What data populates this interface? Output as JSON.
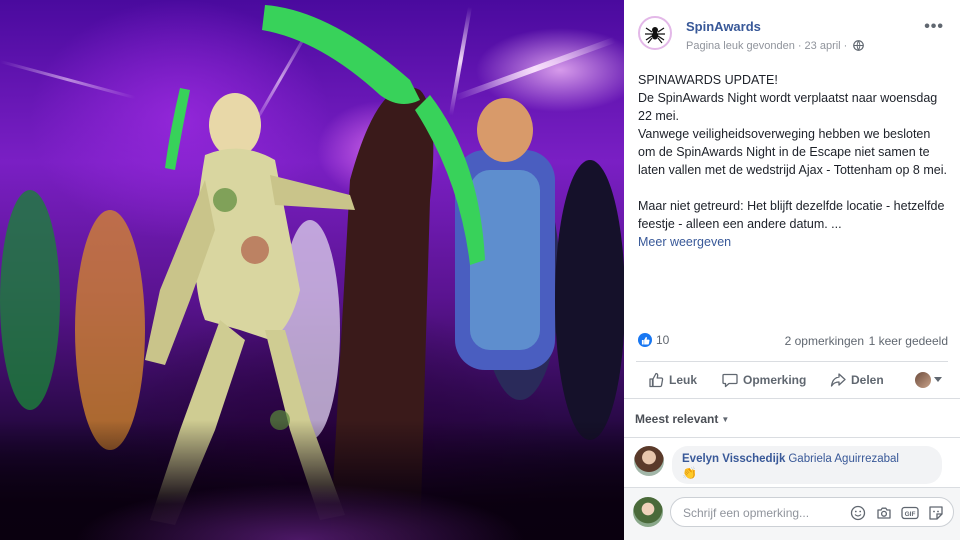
{
  "post": {
    "page_name": "SpinAwards",
    "meta_status": "Pagina leuk gevonden",
    "meta_separator": "·",
    "meta_date": "23 april",
    "meta_separator2": "·",
    "more_label": "•••",
    "text_lines": [
      "SPINAWARDS UPDATE!",
      "De SpinAwards Night wordt verplaatst naar woensdag 22 mei.",
      "Vanwege veiligheidsoverweging hebben we besloten om de SpinAwards Night in de Escape niet samen te laten vallen met de wedstrijd Ajax - Tottenham op 8 mei.",
      "Maar niet getreurd: Het blijft dezelfde locatie - hetzelfde feestje - alleen een andere datum. ..."
    ],
    "see_more": "Meer weergeven"
  },
  "stats": {
    "likes": "10",
    "comments": "2 opmerkingen",
    "shares": "1 keer gedeeld"
  },
  "actions": {
    "like": "Leuk",
    "comment": "Opmerking",
    "share": "Delen"
  },
  "filter": {
    "label": "Meest relevant"
  },
  "comment": {
    "author": "Evelyn Visschedijk",
    "tag": "Gabriela Aguirrezabal",
    "emoji": "👏"
  },
  "composer": {
    "placeholder": "Schrijf een opmerking..."
  },
  "icons": {
    "page_logo": "spider-icon",
    "privacy": "globe-icon",
    "like_reaction": "thumbs-up-icon",
    "like": "thumbs-up-outline-icon",
    "comment": "speech-bubble-icon",
    "share": "share-arrow-icon",
    "emoji": "smiley-icon",
    "camera": "camera-icon",
    "gif": "gif-icon",
    "sticker": "sticker-icon"
  },
  "colors": {
    "brand_link": "#385898",
    "like_blue": "#1877f2",
    "text": "#1d2129",
    "muted": "#90949c"
  }
}
